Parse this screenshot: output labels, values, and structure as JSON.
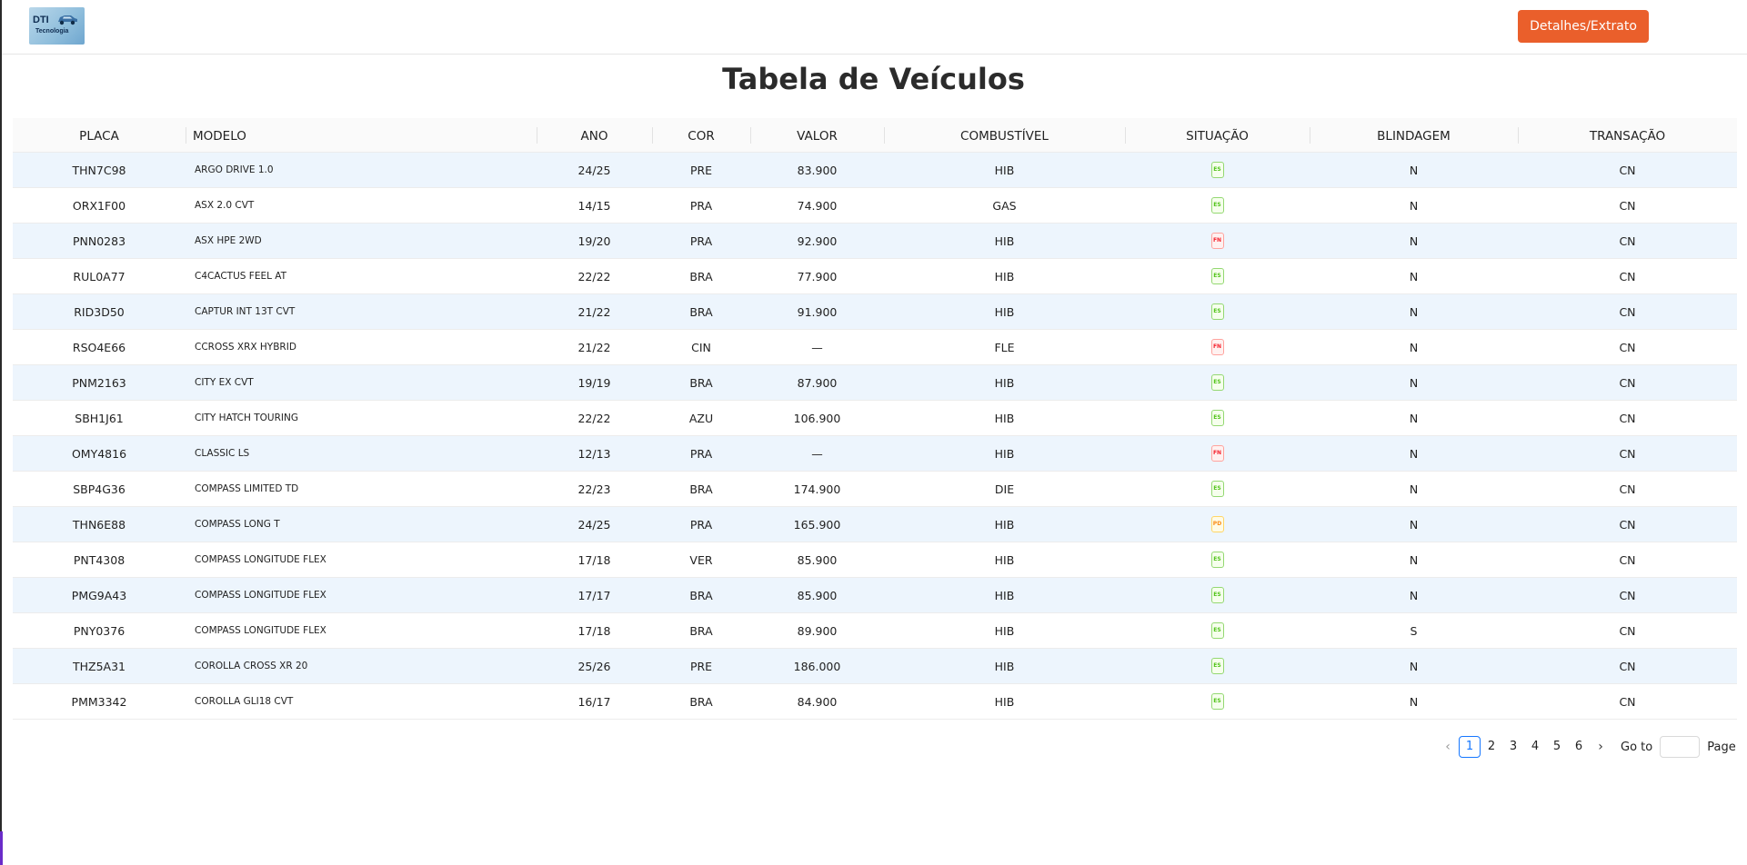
{
  "header": {
    "logo_text": "DTI",
    "logo_sub": "Tecnologia",
    "button_label": "Detalhes/Extrato",
    "button_color": "#ea5f2b"
  },
  "page_title": "Tabela de Veículos",
  "table": {
    "columns": [
      "PLACA",
      "MODELO",
      "ANO",
      "COR",
      "VALOR",
      "COMBUSTÍVEL",
      "SITUAÇÃO",
      "BLINDAGEM",
      "TRANSAÇÃO"
    ],
    "rows": [
      {
        "placa": "THN7C98",
        "modelo": "ARGO DRIVE 1.0",
        "ano": "24/25",
        "cor": "PRE",
        "valor": "83.900",
        "combustivel": "HIB",
        "situacao": "ES",
        "blindagem": "N",
        "transacao": "CN"
      },
      {
        "placa": "ORX1F00",
        "modelo": "ASX 2.0 CVT",
        "ano": "14/15",
        "cor": "PRA",
        "valor": "74.900",
        "combustivel": "GAS",
        "situacao": "ES",
        "blindagem": "N",
        "transacao": "CN"
      },
      {
        "placa": "PNN0283",
        "modelo": "ASX HPE 2WD",
        "ano": "19/20",
        "cor": "PRA",
        "valor": "92.900",
        "combustivel": "HIB",
        "situacao": "FN",
        "blindagem": "N",
        "transacao": "CN"
      },
      {
        "placa": "RUL0A77",
        "modelo": "C4CACTUS FEEL AT",
        "ano": "22/22",
        "cor": "BRA",
        "valor": "77.900",
        "combustivel": "HIB",
        "situacao": "ES",
        "blindagem": "N",
        "transacao": "CN"
      },
      {
        "placa": "RID3D50",
        "modelo": "CAPTUR INT 13T CVT",
        "ano": "21/22",
        "cor": "BRA",
        "valor": "91.900",
        "combustivel": "HIB",
        "situacao": "ES",
        "blindagem": "N",
        "transacao": "CN"
      },
      {
        "placa": "RSO4E66",
        "modelo": "CCROSS XRX HYBRID",
        "ano": "21/22",
        "cor": "CIN",
        "valor": "—",
        "combustivel": "FLE",
        "situacao": "FN",
        "blindagem": "N",
        "transacao": "CN"
      },
      {
        "placa": "PNM2163",
        "modelo": "CITY EX CVT",
        "ano": "19/19",
        "cor": "BRA",
        "valor": "87.900",
        "combustivel": "HIB",
        "situacao": "ES",
        "blindagem": "N",
        "transacao": "CN"
      },
      {
        "placa": "SBH1J61",
        "modelo": "CITY HATCH TOURING",
        "ano": "22/22",
        "cor": "AZU",
        "valor": "106.900",
        "combustivel": "HIB",
        "situacao": "ES",
        "blindagem": "N",
        "transacao": "CN"
      },
      {
        "placa": "OMY4816",
        "modelo": "CLASSIC LS",
        "ano": "12/13",
        "cor": "PRA",
        "valor": "—",
        "combustivel": "HIB",
        "situacao": "FN",
        "blindagem": "N",
        "transacao": "CN"
      },
      {
        "placa": "SBP4G36",
        "modelo": "COMPASS LIMITED TD",
        "ano": "22/23",
        "cor": "BRA",
        "valor": "174.900",
        "combustivel": "DIE",
        "situacao": "ES",
        "blindagem": "N",
        "transacao": "CN"
      },
      {
        "placa": "THN6E88",
        "modelo": "COMPASS LONG T",
        "ano": "24/25",
        "cor": "PRA",
        "valor": "165.900",
        "combustivel": "HIB",
        "situacao": "PD",
        "blindagem": "N",
        "transacao": "CN"
      },
      {
        "placa": "PNT4308",
        "modelo": "COMPASS LONGITUDE FLEX",
        "ano": "17/18",
        "cor": "VER",
        "valor": "85.900",
        "combustivel": "HIB",
        "situacao": "ES",
        "blindagem": "N",
        "transacao": "CN"
      },
      {
        "placa": "PMG9A43",
        "modelo": "COMPASS LONGITUDE FLEX",
        "ano": "17/17",
        "cor": "BRA",
        "valor": "85.900",
        "combustivel": "HIB",
        "situacao": "ES",
        "blindagem": "N",
        "transacao": "CN"
      },
      {
        "placa": "PNY0376",
        "modelo": "COMPASS LONGITUDE FLEX",
        "ano": "17/18",
        "cor": "BRA",
        "valor": "89.900",
        "combustivel": "HIB",
        "situacao": "ES",
        "blindagem": "S",
        "transacao": "CN"
      },
      {
        "placa": "THZ5A31",
        "modelo": "COROLLA CROSS XR 20",
        "ano": "25/26",
        "cor": "PRE",
        "valor": "186.000",
        "combustivel": "HIB",
        "situacao": "ES",
        "blindagem": "N",
        "transacao": "CN"
      },
      {
        "placa": "PMM3342",
        "modelo": "COROLLA GLI18 CVT",
        "ano": "16/17",
        "cor": "BRA",
        "valor": "84.900",
        "combustivel": "HIB",
        "situacao": "ES",
        "blindagem": "N",
        "transacao": "CN"
      }
    ]
  },
  "pagination": {
    "prev_icon": "chevron-left-icon",
    "next_icon": "chevron-right-icon",
    "pages": [
      "1",
      "2",
      "3",
      "4",
      "5",
      "6"
    ],
    "current_page": "1",
    "goto_label": "Go to",
    "page_label": "Page",
    "goto_value": ""
  },
  "colors": {
    "accent": "#ea5f2b",
    "row_alt": "#edf5fd",
    "active_page": "#1677ff",
    "status_es": "#52c41a",
    "status_fn": "#f5222d",
    "status_pd": "#fa8c16"
  }
}
